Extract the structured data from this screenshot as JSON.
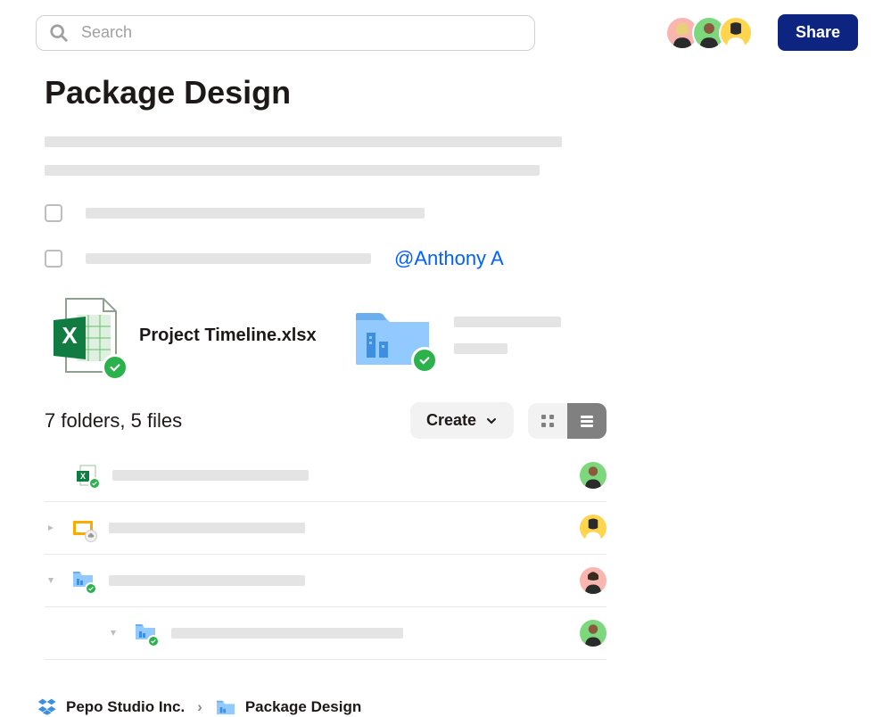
{
  "search": {
    "placeholder": "Search"
  },
  "share_button": "Share",
  "page_title": "Package Design",
  "mention": "@Anthony A",
  "excel_attachment": "Project Timeline.xlsx",
  "listing_count": "7 folders, 5 files",
  "create_button": "Create",
  "breadcrumb": {
    "root": "Pepo Studio Inc.",
    "current": "Package Design"
  },
  "avatars": [
    {
      "bg": "#f9b5b0"
    },
    {
      "bg": "#7dd87d"
    },
    {
      "bg": "#ffd54f"
    }
  ],
  "rows": [
    {
      "type": "excel",
      "avatar_bg": "#7dd87d"
    },
    {
      "type": "slides",
      "avatar_bg": "#ffd54f"
    },
    {
      "type": "folder",
      "expanded": true,
      "avatar_bg": "#f9b5b0"
    },
    {
      "type": "folder",
      "indent": true,
      "expanded": true,
      "avatar_bg": "#7dd87d"
    }
  ]
}
